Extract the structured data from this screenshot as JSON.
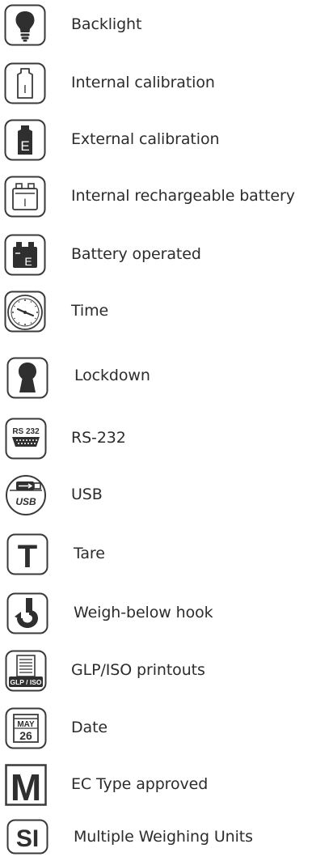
{
  "features": [
    {
      "icon": "backlight-icon",
      "label": "Backlight"
    },
    {
      "icon": "internal-calibration-icon",
      "label": "Internal calibration",
      "badge": "I"
    },
    {
      "icon": "external-calibration-icon",
      "label": "External calibration",
      "badge": "E"
    },
    {
      "icon": "internal-rechargeable-battery-icon",
      "label": "Internal rechargeable battery",
      "badge": "I"
    },
    {
      "icon": "battery-operated-icon",
      "label": "Battery operated",
      "badge": "E"
    },
    {
      "icon": "clock-icon",
      "label": "Time"
    },
    {
      "icon": "keyhole-icon",
      "label": "Lockdown"
    },
    {
      "icon": "rs232-port-icon",
      "label": "RS-232",
      "badge": "RS 232"
    },
    {
      "icon": "usb-icon",
      "label": "USB",
      "badge": "USB"
    },
    {
      "icon": "tare-icon",
      "label": "Tare",
      "badge": "T"
    },
    {
      "icon": "hook-icon",
      "label": "Weigh-below hook"
    },
    {
      "icon": "printout-icon",
      "label": "GLP/ISO printouts",
      "badge": "GLP / ISO"
    },
    {
      "icon": "calendar-icon",
      "label": "Date",
      "month": "MAY",
      "day": "26"
    },
    {
      "icon": "ec-approval-icon",
      "label": "EC Type approved",
      "badge": "M"
    },
    {
      "icon": "si-units-icon",
      "label": "Multiple Weighing Units",
      "badge": "SI"
    }
  ],
  "colors": {
    "icon": "#3a3a3a",
    "icon_fill": "#2f2f2f",
    "text": "#2c2c2c"
  }
}
